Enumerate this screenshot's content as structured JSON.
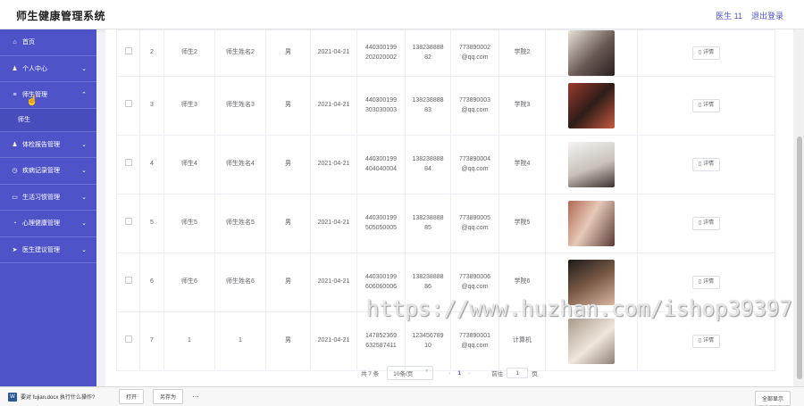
{
  "header": {
    "title": "师生健康管理系统",
    "user": "医生 11",
    "logout": "退出登录"
  },
  "sidebar": {
    "items": [
      {
        "label": "首页",
        "icon": "home-icon",
        "glyph": "⌂",
        "chevron": ""
      },
      {
        "label": "个人中心",
        "icon": "user-icon",
        "glyph": "♟",
        "chevron": "⌄"
      },
      {
        "label": "师生管理",
        "icon": "list-icon",
        "glyph": "≡",
        "chevron": "⌃"
      },
      {
        "label": "体检报告管理",
        "icon": "user-icon",
        "glyph": "♟",
        "chevron": "⌄"
      },
      {
        "label": "疾病记录管理",
        "icon": "clock-icon",
        "glyph": "◷",
        "chevron": "⌄"
      },
      {
        "label": "生活习惯管理",
        "icon": "card-icon",
        "glyph": "▭",
        "chevron": "⌄"
      },
      {
        "label": "心理健康管理",
        "icon": "circle-icon",
        "glyph": "◔",
        "chevron": "⌄"
      },
      {
        "label": "医生建议管理",
        "icon": "send-icon",
        "glyph": "➤",
        "chevron": "⌄"
      }
    ],
    "submenu": {
      "label": "师生"
    }
  },
  "table": {
    "rows": [
      {
        "index": "2",
        "account": "师生2",
        "name": "师生姓名2",
        "gender": "男",
        "date": "2021-04-21",
        "id1": "440300199",
        "id2": "202020002",
        "phone1": "138238888",
        "phone2": "82",
        "email1": "773890002",
        "email2": "@qq.com",
        "college": "学院2",
        "detail": "详情"
      },
      {
        "index": "3",
        "account": "师生3",
        "name": "师生姓名3",
        "gender": "男",
        "date": "2021-04-21",
        "id1": "440300199",
        "id2": "303030003",
        "phone1": "138238888",
        "phone2": "83",
        "email1": "773890003",
        "email2": "@qq.com",
        "college": "学院3",
        "detail": "详情"
      },
      {
        "index": "4",
        "account": "师生4",
        "name": "师生姓名4",
        "gender": "男",
        "date": "2021-04-21",
        "id1": "440300199",
        "id2": "404040004",
        "phone1": "138238888",
        "phone2": "84",
        "email1": "773890004",
        "email2": "@qq.com",
        "college": "学院4",
        "detail": "详情"
      },
      {
        "index": "5",
        "account": "师生5",
        "name": "师生姓名5",
        "gender": "男",
        "date": "2021-04-21",
        "id1": "440300199",
        "id2": "505050005",
        "phone1": "138238888",
        "phone2": "85",
        "email1": "773890005",
        "email2": "@qq.com",
        "college": "学院5",
        "detail": "详情"
      },
      {
        "index": "6",
        "account": "师生6",
        "name": "师生姓名6",
        "gender": "男",
        "date": "2021-04-21",
        "id1": "440300199",
        "id2": "606060006",
        "phone1": "138238888",
        "phone2": "86",
        "email1": "773890006",
        "email2": "@qq.com",
        "college": "学院6",
        "detail": "详情"
      },
      {
        "index": "7",
        "account": "1",
        "name": "1",
        "gender": "男",
        "date": "2021-04-21",
        "id1": "147852369",
        "id2": "632587411",
        "phone1": "123456789",
        "phone2": "10",
        "email1": "773890001",
        "email2": "@qq.com",
        "college": "计算机",
        "detail": "详情"
      }
    ]
  },
  "pagination": {
    "total": "共 7 条",
    "page_size": "10条/页",
    "prev": "‹",
    "current": "1",
    "next": "›",
    "goto_label": "前往",
    "goto_value": "1",
    "page_unit": "页"
  },
  "watermark": "https://www.huzhan.com/ishop39397",
  "download_bar": {
    "file_text": "要对 fujian.docx 执行什么操作?",
    "open": "打开",
    "save_as": "另存为",
    "more": "···",
    "show_all": "全部显示"
  }
}
